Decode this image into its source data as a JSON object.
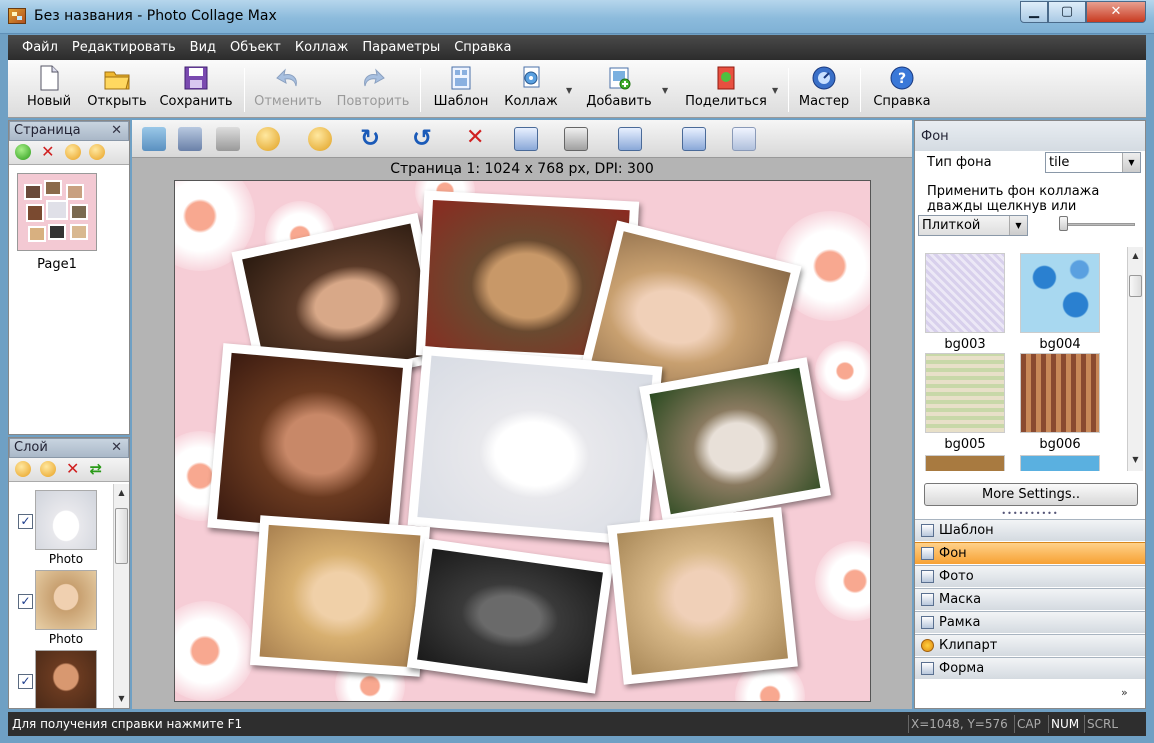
{
  "window": {
    "title": "Без названия - Photo Collage Max"
  },
  "menu": [
    "Файл",
    "Редактировать",
    "Вид",
    "Объект",
    "Коллаж",
    "Параметры",
    "Справка"
  ],
  "toolbar": {
    "new": "Новый",
    "open": "Открыть",
    "save": "Сохранить",
    "undo": "Отменить",
    "redo": "Повторить",
    "template": "Шаблон",
    "collage": "Коллаж",
    "add": "Добавить",
    "share": "Поделиться",
    "wizard": "Мастер",
    "help": "Справка"
  },
  "page_panel": {
    "title": "Страница",
    "pages": [
      {
        "label": "Page1"
      }
    ]
  },
  "layer_panel": {
    "title": "Слой",
    "layers": [
      {
        "label": "Photo",
        "checked": "✓"
      },
      {
        "label": "Photo",
        "checked": "✓"
      },
      {
        "label": "",
        "checked": "✓"
      }
    ]
  },
  "canvas": {
    "info": "Страница 1: 1024 x 768 px, DPI: 300"
  },
  "background": {
    "header": "Фон",
    "type_label": "Тип фона",
    "type_value": "tile",
    "apply_text": "Применить фон коллажа дважды щелкнув или",
    "mode_value": "Плиткой",
    "thumbs": [
      "bg003",
      "bg004",
      "bg005",
      "bg006"
    ],
    "more_button": "More Settings.."
  },
  "nav": [
    "Шаблон",
    "Фон",
    "Фото",
    "Маска",
    "Рамка",
    "Клипарт",
    "Форма"
  ],
  "nav_active": "Фон",
  "status": {
    "help": "Для получения справки нажмите F1",
    "coords": "X=1048, Y=576",
    "cap": "CAP",
    "num": "NUM",
    "scrl": "SCRL"
  }
}
